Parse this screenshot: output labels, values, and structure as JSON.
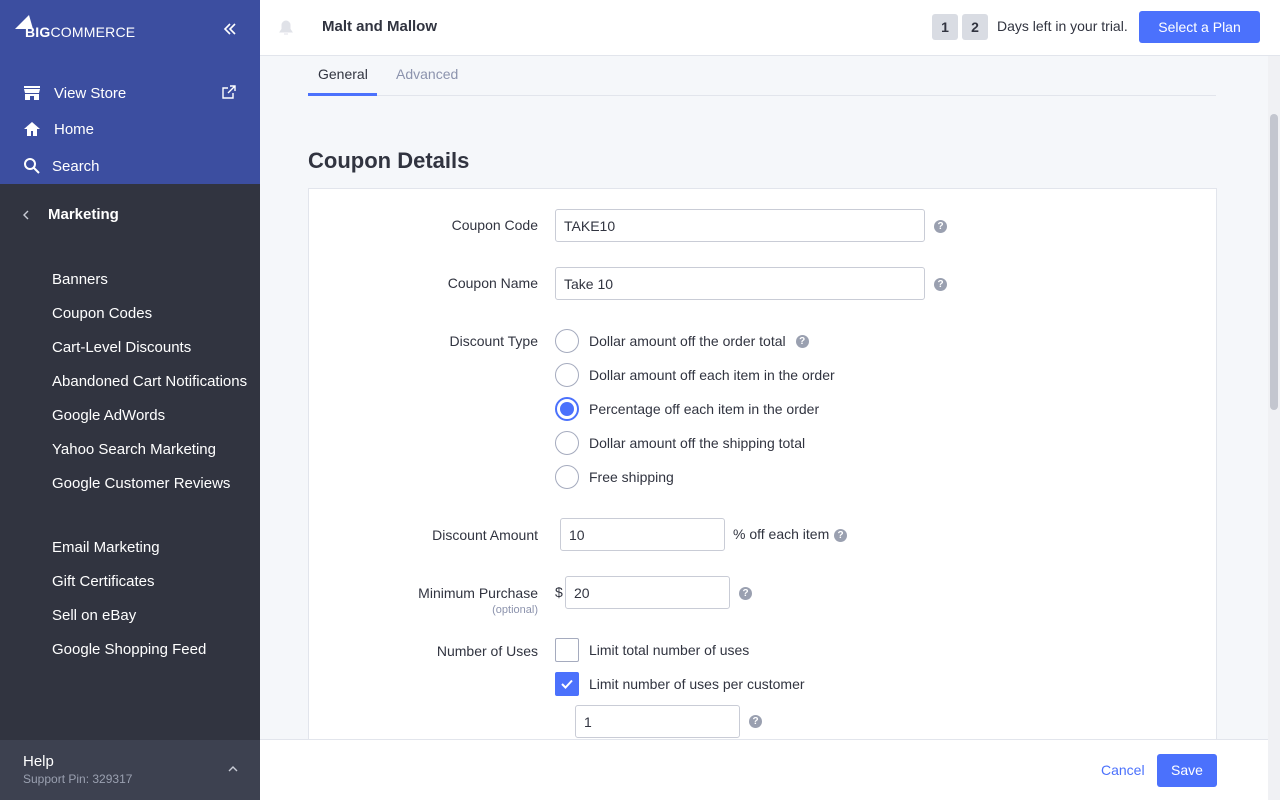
{
  "sidebar": {
    "logo": {
      "big": "BIG",
      "commerce": "COMMERCE"
    },
    "top_items": [
      {
        "label": "View Store",
        "icon": "store-icon"
      },
      {
        "label": "Home",
        "icon": "home-icon"
      },
      {
        "label": "Search",
        "icon": "search-icon"
      }
    ],
    "section_title": "Marketing",
    "menu_group_1": [
      "Banners",
      "Coupon Codes",
      "Cart-Level Discounts",
      "Abandoned Cart Notifications",
      "Google AdWords",
      "Yahoo Search Marketing",
      "Google Customer Reviews"
    ],
    "menu_group_2": [
      "Email Marketing",
      "Gift Certificates",
      "Sell on eBay",
      "Google Shopping Feed"
    ],
    "help": {
      "title": "Help",
      "pin": "Support Pin: 329317"
    }
  },
  "header": {
    "store_name": "Malt and Mallow",
    "trial_digits": [
      "1",
      "2"
    ],
    "trial_text": "Days left in your trial.",
    "plan_button": "Select a Plan"
  },
  "tabs": [
    {
      "label": "General",
      "active": true
    },
    {
      "label": "Advanced",
      "active": false
    }
  ],
  "section_title": "Coupon Details",
  "form": {
    "coupon_code": {
      "label": "Coupon Code",
      "value": "TAKE10"
    },
    "coupon_name": {
      "label": "Coupon Name",
      "value": "Take 10"
    },
    "discount_type": {
      "label": "Discount Type",
      "options": [
        {
          "label": "Dollar amount off the order total",
          "checked": false,
          "help": true
        },
        {
          "label": "Dollar amount off each item in the order",
          "checked": false
        },
        {
          "label": "Percentage off each item in the order",
          "checked": true
        },
        {
          "label": "Dollar amount off the shipping total",
          "checked": false
        },
        {
          "label": "Free shipping",
          "checked": false
        }
      ]
    },
    "discount_amount": {
      "label": "Discount Amount",
      "value": "10",
      "suffix": "% off each item"
    },
    "minimum_purchase": {
      "label": "Minimum Purchase",
      "sublabel": "(optional)",
      "prefix": "$",
      "value": "20"
    },
    "number_of_uses": {
      "label": "Number of Uses",
      "options": [
        {
          "label": "Limit total number of uses",
          "checked": false
        },
        {
          "label": "Limit number of uses per customer",
          "checked": true
        }
      ],
      "per_customer_value": "1"
    },
    "help_glyph": "?"
  },
  "footer": {
    "cancel": "Cancel",
    "save": "Save"
  },
  "colors": {
    "accent": "#4b71fc",
    "sidebar_top": "#3c4ea0",
    "sidebar": "#313440"
  }
}
